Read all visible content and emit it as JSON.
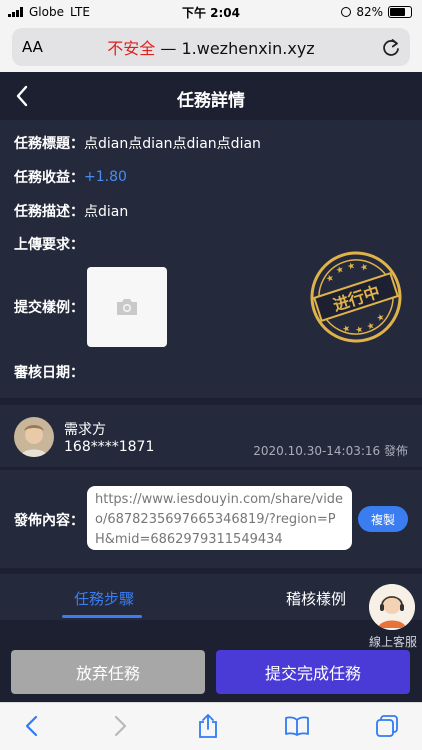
{
  "status_bar": {
    "carrier": "Globe",
    "network": "LTE",
    "time": "下午 2:04",
    "battery_percent": "82%",
    "battery_level": 0.82
  },
  "browser": {
    "text_size_label": "AA",
    "url_warning": "不安全",
    "url_separator": " — ",
    "url_host": "1.wezhenxin.xyz"
  },
  "header": {
    "title": "任務詳情"
  },
  "task": {
    "title_label": "任務標題：",
    "title_value": "点dian点dian点dian点dian",
    "reward_label": "任務收益：",
    "reward_value": "+1.80",
    "desc_label": "任務描述：",
    "desc_value": "点dian",
    "upload_label": "上傳要求：",
    "sample_label": "提交樣例：",
    "review_label": "審核日期：",
    "stamp_text": "进行中"
  },
  "requester": {
    "name": "需求方",
    "phone": "168****1871",
    "published": "2020.10.30-14:03:16 發佈"
  },
  "content": {
    "label": "發佈內容：",
    "link": "https://www.iesdouyin.com/share/video/6878235697665346819/?region=PH&mid=6862979311549434",
    "copy_label": "複製"
  },
  "tabs": {
    "steps": "任務步驟",
    "review_sample": "稽核樣例"
  },
  "customer_service": {
    "label": "線上客服"
  },
  "actions": {
    "abandon": "放弃任務",
    "submit": "提交完成任務"
  },
  "colors": {
    "accent": "#3a7df1",
    "submit": "#4b3bd6",
    "stamp": "#e0b24a",
    "warning": "#e02020"
  }
}
